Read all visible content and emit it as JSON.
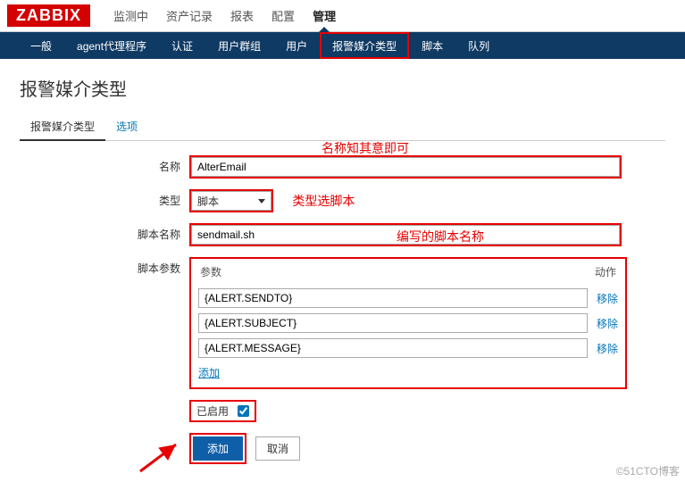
{
  "logo": "ZABBIX",
  "topnav": {
    "items": [
      "监测中",
      "资产记录",
      "报表",
      "配置",
      "管理"
    ],
    "activeIndex": 4
  },
  "subnav": {
    "items": [
      "一般",
      "agent代理程序",
      "认证",
      "用户群组",
      "用户",
      "报警媒介类型",
      "脚本",
      "队列"
    ],
    "activeIndex": 5
  },
  "page_title": "报警媒介类型",
  "tabs": {
    "items": [
      "报警媒介类型",
      "选项"
    ],
    "activeIndex": 0
  },
  "annotations": {
    "name_hint": "名称知其意即可",
    "type_hint": "类型选脚本",
    "scriptname_hint": "编写的脚本名称"
  },
  "form": {
    "name": {
      "label": "名称",
      "value": "AlterEmail"
    },
    "type": {
      "label": "类型",
      "value": "脚本"
    },
    "scriptname": {
      "label": "脚本名称",
      "value": "sendmail.sh"
    },
    "params": {
      "label": "脚本参数",
      "header_param": "参数",
      "header_action": "动作",
      "rows": [
        "{ALERT.SENDTO}",
        "{ALERT.SUBJECT}",
        "{ALERT.MESSAGE}"
      ],
      "remove": "移除",
      "add": "添加"
    },
    "enabled": {
      "label": "已启用",
      "checked": true
    }
  },
  "buttons": {
    "add": "添加",
    "cancel": "取消"
  },
  "watermark": "©51CTO博客"
}
